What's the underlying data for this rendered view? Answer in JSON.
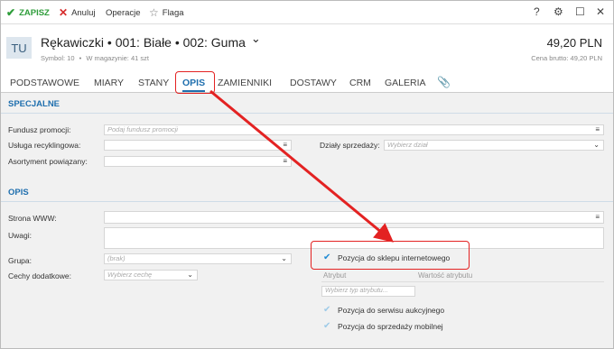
{
  "toolbar": {
    "save_label": "ZAPISZ",
    "cancel_label": "Anuluj",
    "operations_label": "Operacje",
    "flag_label": "Flaga",
    "help": "?"
  },
  "header": {
    "avatar": "TU",
    "title": "Rękawiczki • 001: Białe • 002: Guma",
    "chevron": "⌄",
    "symbol": "Symbol: 10",
    "stock": "W magazynie: 41 szt",
    "price": "49,20 PLN",
    "gross_label": "Cena brutto: 49,20 PLN"
  },
  "tabs": [
    {
      "label": "PODSTAWOWE"
    },
    {
      "label": "MIARY"
    },
    {
      "label": "STANY"
    },
    {
      "label": "OPIS"
    },
    {
      "label": "ZAMIENNIKI"
    },
    {
      "label": "DOSTAWY"
    },
    {
      "label": "CRM"
    },
    {
      "label": "GALERIA"
    }
  ],
  "specjalne": {
    "heading": "SPECJALNE",
    "fundusz_label": "Fundusz promocji:",
    "fundusz_placeholder": "Podaj fundusz promocji",
    "usluga_label": "Usługa recyklingowa:",
    "asortyment_label": "Asortyment powiązany:",
    "dzialy_label": "Działy sprzedaży:",
    "dzialy_placeholder": "Wybierz dział"
  },
  "opis": {
    "heading": "OPIS",
    "www_label": "Strona WWW:",
    "uwagi_label": "Uwagi:",
    "grupa_label": "Grupa:",
    "grupa_value": "(brak)",
    "cechy_label": "Cechy dodatkowe:",
    "cechy_placeholder": "Wybierz cechę",
    "check_internet": "Pozycja do sklepu internetowego",
    "atrybut_header": "Atrybut",
    "wartosc_header": "Wartość atrybutu",
    "atrybut_placeholder": "Wybierz typ atrybutu...",
    "check_aukcje": "Pozycja do serwisu aukcyjnego",
    "check_mobile": "Pozycja do sprzedaży mobilnej"
  },
  "colors": {
    "accent": "#1f6fae",
    "save_green": "#2e9d3a",
    "cancel_red": "#d62b2b",
    "highlight_red": "#e32222"
  }
}
